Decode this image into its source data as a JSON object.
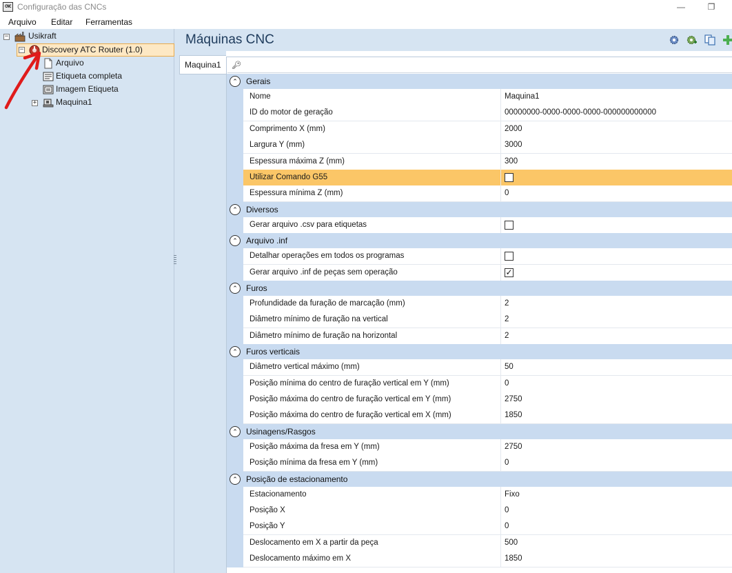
{
  "window": {
    "title": "Configuração das CNCs",
    "app_icon_text": "CNC"
  },
  "menu": [
    "Arquivo",
    "Editar",
    "Ferramentas"
  ],
  "tree": {
    "root": "Usikraft",
    "machine": "Discovery ATC Router (1.0)",
    "children": [
      "Arquivo",
      "Etiqueta completa",
      "Imagem Etiqueta",
      "Maquina1"
    ]
  },
  "header": {
    "title": "Máquinas CNC"
  },
  "tab": {
    "label": "Maquina1"
  },
  "grid": {
    "categories": [
      {
        "label": "Gerais",
        "rows": [
          {
            "name": "Nome",
            "value": "Maquina1"
          },
          {
            "name": "ID do motor de geração",
            "value": "00000000-0000-0000-0000-000000000000"
          },
          {
            "name": "Comprimento X (mm)",
            "value": "2000"
          },
          {
            "name": "Largura Y (mm)",
            "value": "3000"
          },
          {
            "name": "Espessura máxima Z (mm)",
            "value": "300"
          },
          {
            "name": "Utilizar Comando G55",
            "value": "",
            "checkbox": true,
            "checked": false,
            "highlight": true
          },
          {
            "name": "Espessura mínima Z (mm)",
            "value": "0"
          }
        ]
      },
      {
        "label": "Diversos",
        "rows": [
          {
            "name": "Gerar arquivo .csv para etiquetas",
            "value": "",
            "checkbox": true,
            "checked": false
          }
        ]
      },
      {
        "label": "Arquivo .inf",
        "rows": [
          {
            "name": "Detalhar operações em todos os programas",
            "value": "",
            "checkbox": true,
            "checked": false
          },
          {
            "name": "Gerar arquivo .inf de peças sem operação",
            "value": "",
            "checkbox": true,
            "checked": true
          }
        ]
      },
      {
        "label": "Furos",
        "rows": [
          {
            "name": "Profundidade da furação de marcação (mm)",
            "value": "2"
          },
          {
            "name": "Diâmetro mínimo de furação na vertical",
            "value": "2"
          },
          {
            "name": "Diâmetro mínimo de furação na horizontal",
            "value": "2"
          }
        ]
      },
      {
        "label": "Furos verticais",
        "rows": [
          {
            "name": "Diâmetro vertical máximo (mm)",
            "value": "50"
          },
          {
            "name": "Posição mínima do centro de furação vertical em Y (mm)",
            "value": "0"
          },
          {
            "name": "Posição máxima do centro de furação vertical em Y (mm)",
            "value": "2750"
          },
          {
            "name": "Posição máxima do centro de furação vertical em X (mm)",
            "value": "1850"
          }
        ]
      },
      {
        "label": "Usinagens/Rasgos",
        "rows": [
          {
            "name": "Posição máxima da fresa em Y (mm)",
            "value": "2750"
          },
          {
            "name": "Posição mínima da fresa em Y (mm)",
            "value": "0"
          }
        ]
      },
      {
        "label": "Posição de estacionamento",
        "rows": [
          {
            "name": "Estacionamento",
            "value": "Fixo"
          },
          {
            "name": "Posição X",
            "value": "0"
          },
          {
            "name": "Posição Y",
            "value": "0"
          },
          {
            "name": "Deslocamento em X a partir da peça",
            "value": "500"
          },
          {
            "name": "Deslocamento máximo em X",
            "value": "1850"
          }
        ]
      }
    ]
  },
  "colors": {
    "panel": "#d6e4f2",
    "category": "#c9dbf0",
    "highlight": "#fbc667",
    "selection": "#fde8c4",
    "annotation": "#e01b1b"
  }
}
